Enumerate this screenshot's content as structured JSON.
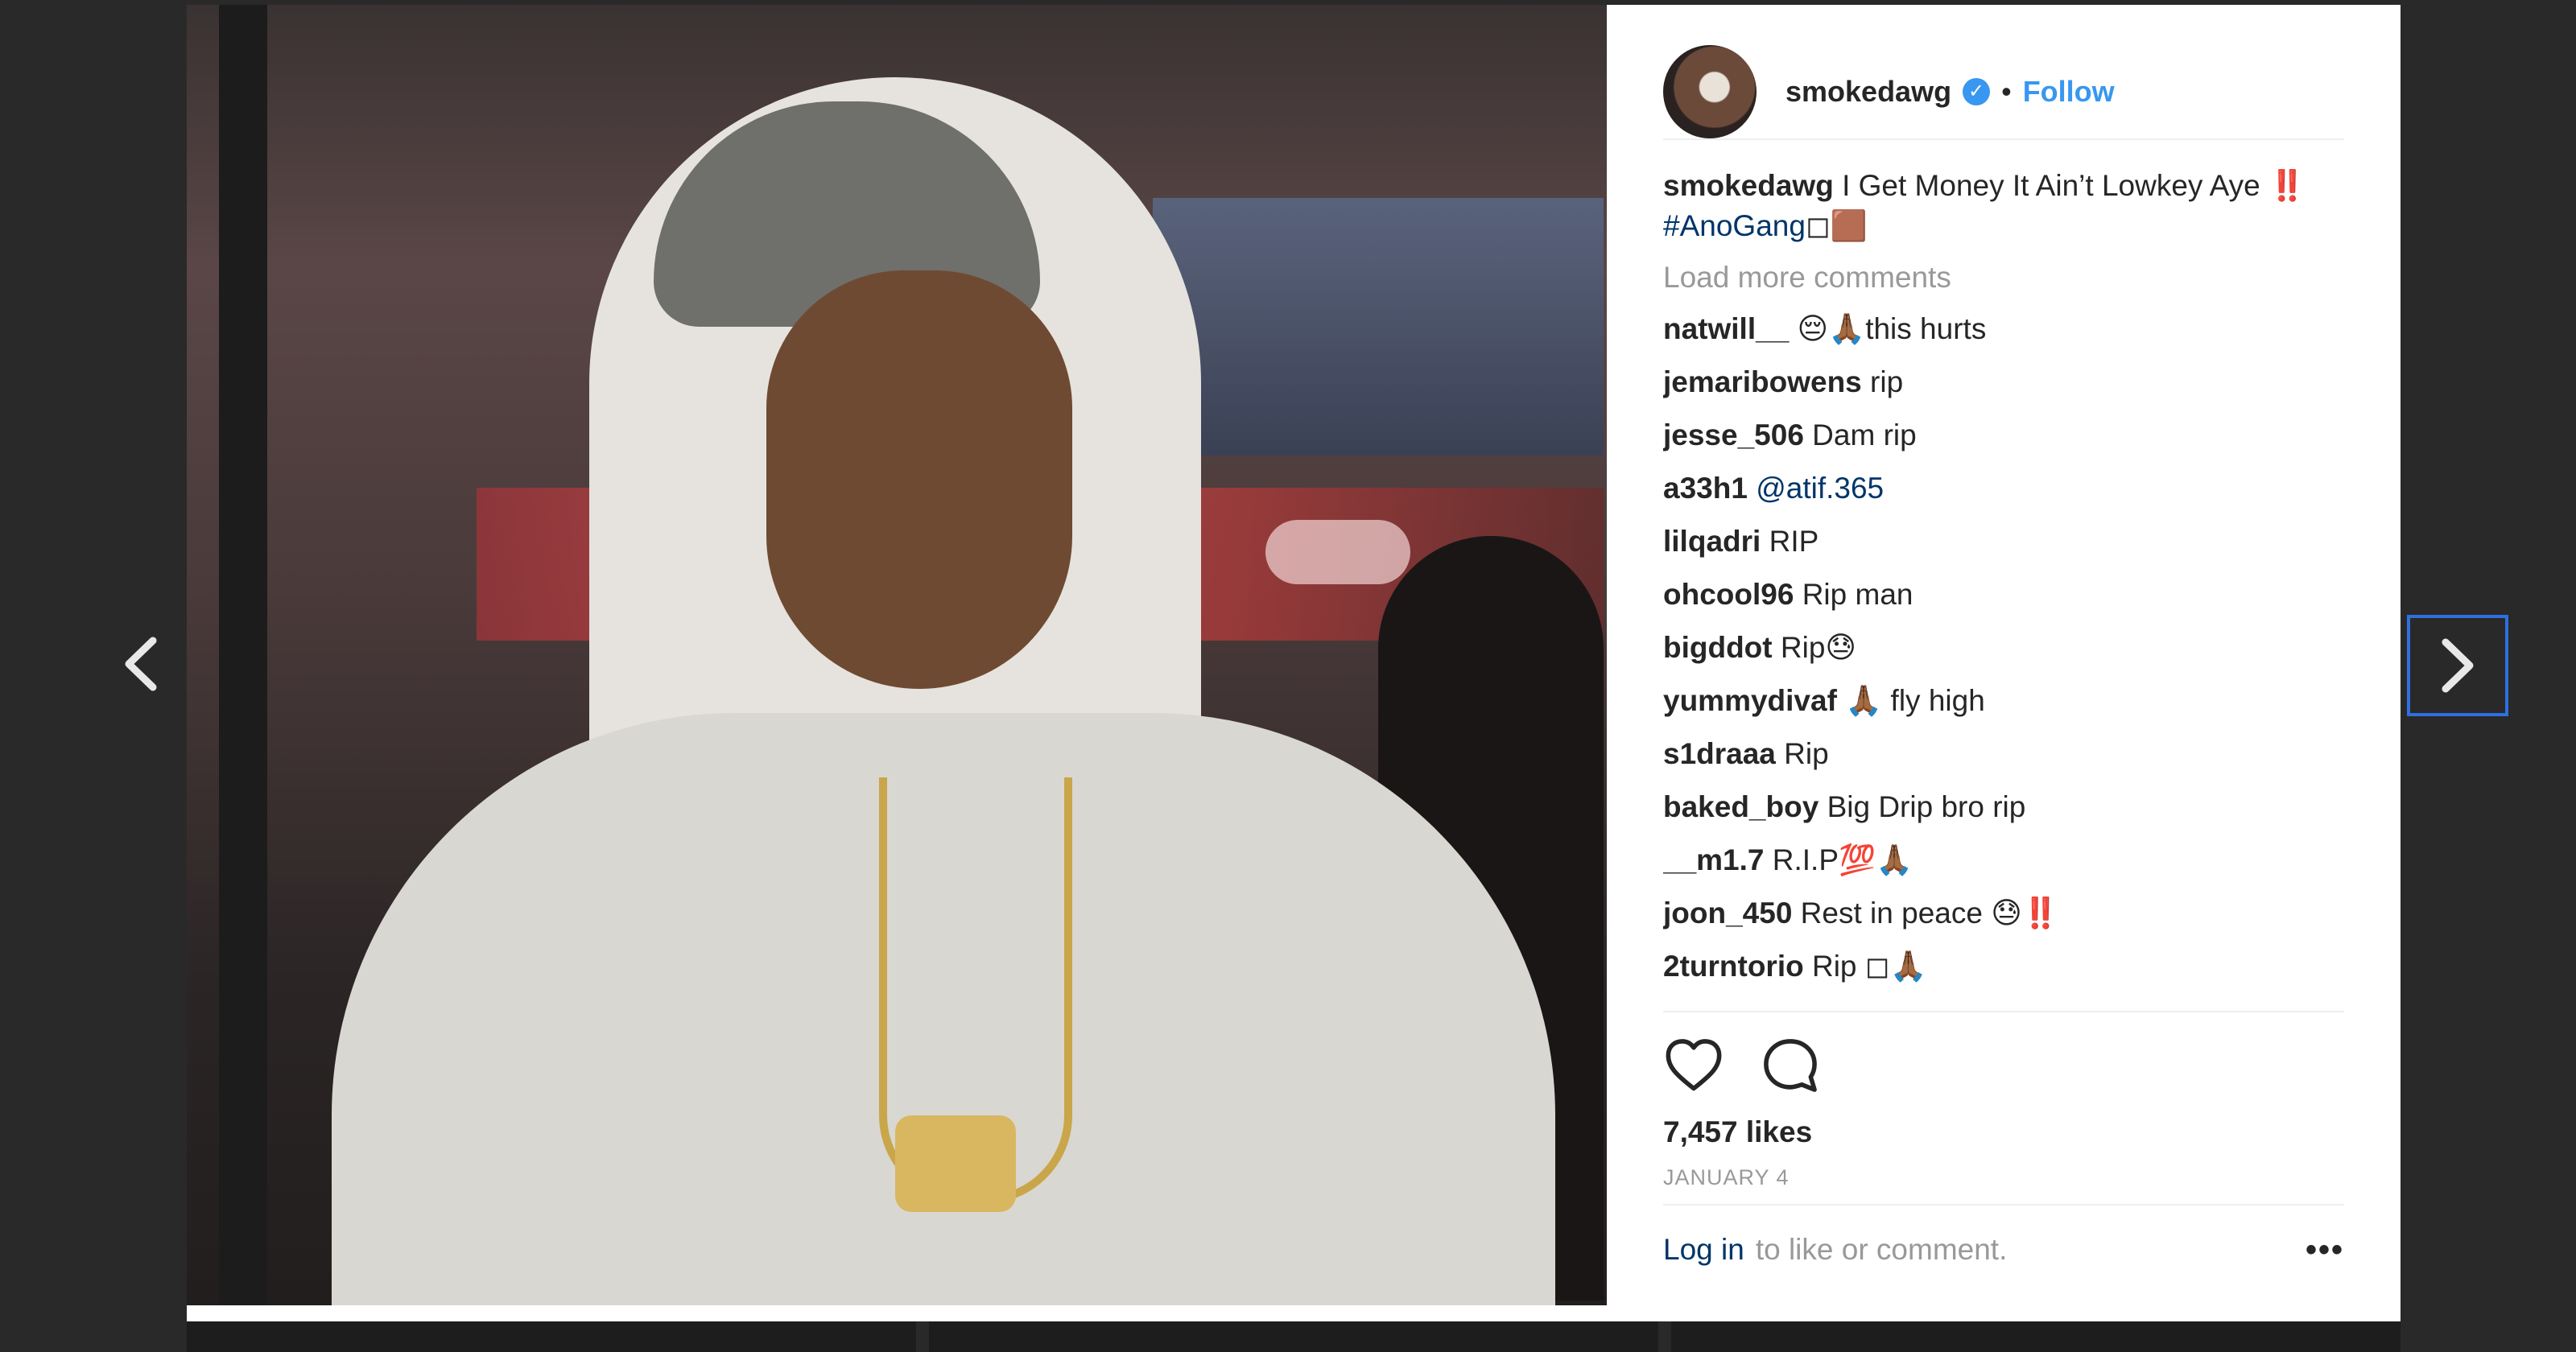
{
  "post": {
    "username": "smokedawg",
    "separator": "•",
    "follow_label": "Follow",
    "caption_user": "smokedawg",
    "caption_text": " I Get Money It Ain’t Lowkey Aye ‼️ ",
    "caption_hashtag": "#AnoGang",
    "caption_tail": "◻🟫",
    "load_more_label": "Load more comments",
    "likes": "7,457 likes",
    "date": "JANUARY 4",
    "login_label": "Log in",
    "login_suffix": "to like or comment.",
    "more_options": "•••"
  },
  "comments": [
    {
      "user": "natwill__",
      "text": " 😔🙏🏾this hurts"
    },
    {
      "user": "jemaribowens",
      "text": " rip"
    },
    {
      "user": "jesse_506",
      "text": " Dam rip"
    },
    {
      "user": "a33h1",
      "text": " @atif.365"
    },
    {
      "user": "lilqadri",
      "text": " RIP"
    },
    {
      "user": "ohcool96",
      "text": " Rip man"
    },
    {
      "user": "bigddot",
      "text": " Rip😓"
    },
    {
      "user": "yummydivaf",
      "text": " 🙏🏾 fly high"
    },
    {
      "user": "s1draaa",
      "text": " Rip"
    },
    {
      "user": "baked_boy",
      "text": " Big Drip bro rip"
    },
    {
      "user": "__m1.7",
      "text": " R.I.P💯🙏🏾"
    },
    {
      "user": "joon_450",
      "text": " Rest in peace 😓‼️"
    },
    {
      "user": "2turntorio",
      "text": " Rip ◻🙏🏾"
    }
  ],
  "icons": {
    "prev": "chevron-left-icon",
    "next": "chevron-right-icon",
    "like": "heart-icon",
    "comment": "comment-icon",
    "verified": "verified-badge-icon"
  },
  "colors": {
    "accent": "#3897f0",
    "link": "#003569",
    "muted": "#999999",
    "text": "#262626"
  }
}
